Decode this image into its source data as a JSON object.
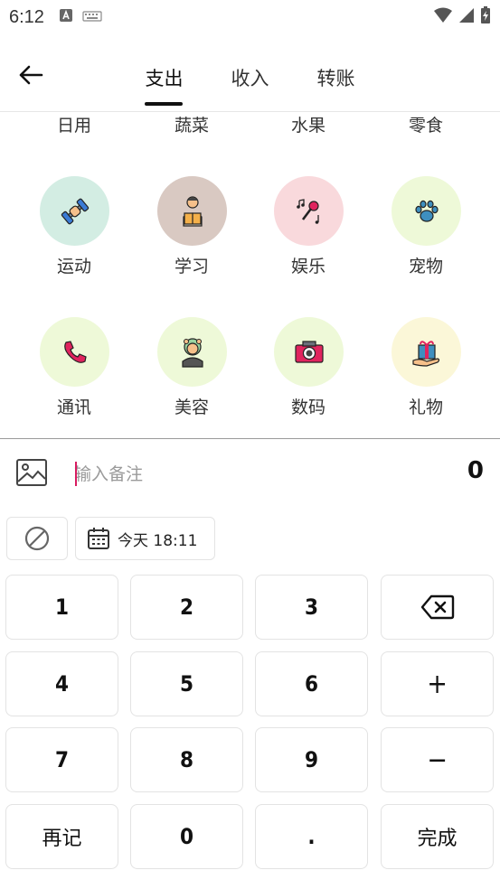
{
  "status_bar": {
    "time": "6:12"
  },
  "header": {
    "tabs": [
      {
        "label": "支出",
        "active": true
      },
      {
        "label": "收入",
        "active": false
      },
      {
        "label": "转账",
        "active": false
      }
    ]
  },
  "categories": {
    "partial_row": [
      "日用",
      "蔬菜",
      "水果",
      "零食"
    ],
    "items": [
      {
        "label": "运动",
        "icon": "dumbbell-icon",
        "color": "#d3ede3"
      },
      {
        "label": "学习",
        "icon": "reading-person-icon",
        "color": "#d9c9c2"
      },
      {
        "label": "娱乐",
        "icon": "microphone-music-icon",
        "color": "#f9d9dc"
      },
      {
        "label": "宠物",
        "icon": "paw-icon",
        "color": "#eef9d8"
      },
      {
        "label": "通讯",
        "icon": "phone-icon",
        "color": "#eef9d8"
      },
      {
        "label": "美容",
        "icon": "beauty-person-icon",
        "color": "#eef9d8"
      },
      {
        "label": "数码",
        "icon": "camera-icon",
        "color": "#eef9d8"
      },
      {
        "label": "礼物",
        "icon": "gift-icon",
        "color": "#fbf7d8"
      }
    ]
  },
  "note": {
    "placeholder": "输入备注",
    "amount": "0",
    "cursor_color": "#d81b60"
  },
  "tags": {
    "date_label": "今天 18:11"
  },
  "keypad": {
    "keys": [
      "1",
      "2",
      "3",
      "",
      "4",
      "5",
      "6",
      "+",
      "7",
      "8",
      "9",
      "−",
      "再记",
      "0",
      ".",
      "完成"
    ]
  }
}
